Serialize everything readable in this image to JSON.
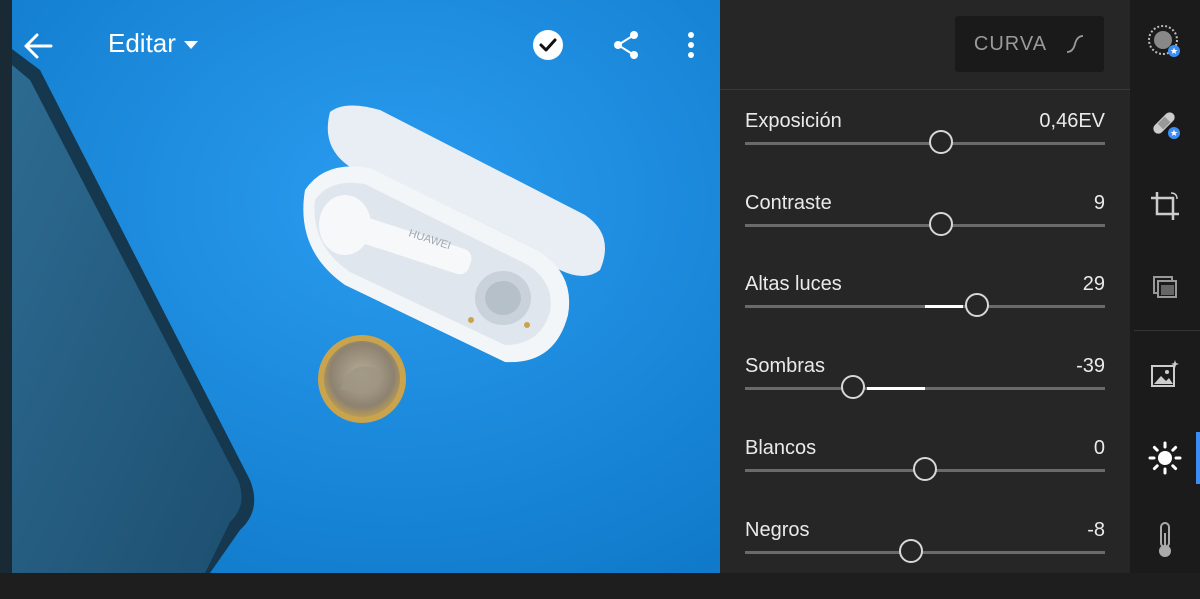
{
  "topbar": {
    "title": "Editar",
    "icons": {
      "back": "arrow-left-icon",
      "done": "check-circle-icon",
      "share": "share-icon",
      "more": "more-vertical-icon"
    }
  },
  "panel": {
    "curve_label": "CURVA",
    "adjustments": [
      {
        "label": "Exposición",
        "value": "0,46EV",
        "position": 0.545
      },
      {
        "label": "Contraste",
        "value": "9",
        "position": 0.545
      },
      {
        "label": "Altas luces",
        "value": "29",
        "position": 0.645
      },
      {
        "label": "Sombras",
        "value": "-39",
        "position": 0.3
      },
      {
        "label": "Blancos",
        "value": "0",
        "position": 0.5
      },
      {
        "label": "Negros",
        "value": "-8",
        "position": 0.46
      }
    ]
  },
  "toolbar": {
    "tools": [
      "selective-edit-icon",
      "healing-icon",
      "crop-icon",
      "presets-icon",
      "auto-icon",
      "light-icon",
      "color-temperature-icon"
    ],
    "active": "light-icon"
  },
  "photo_text": {
    "brand": "HUAWEI"
  },
  "colors": {
    "accent": "#3b8ef5",
    "panel_bg": "#262626",
    "photo_bg": "#1a8fe0"
  }
}
